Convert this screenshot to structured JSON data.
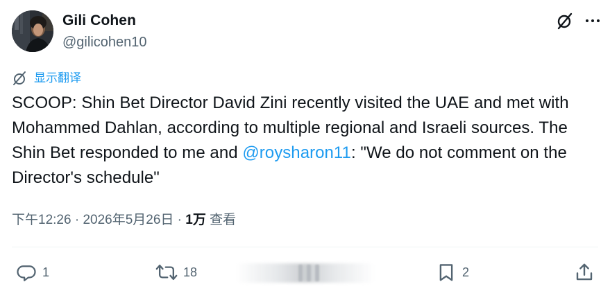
{
  "author": {
    "display_name": "Gili Cohen",
    "handle": "@gilicohen10"
  },
  "header_icons": {
    "grok": "grok-icon",
    "more": "more-icon"
  },
  "translate": {
    "icon": "translate-icon",
    "label": "显示翻译"
  },
  "tweet": {
    "text_part1": "SCOOP: Shin Bet Director David Zini recently visited the UAE and met with Mohammed Dahlan, according to multiple regional and Israeli sources. The Shin Bet responded to me and ",
    "mention": "@roysharon11",
    "text_part2": ": \"We do not comment on the Director's schedule\""
  },
  "meta": {
    "time": "下午12:26",
    "separator1": " · ",
    "date": "2026年5月26日",
    "separator2": " · ",
    "views_count": "1万",
    "views_label": " 查看"
  },
  "actions": {
    "reply": {
      "icon": "reply-icon",
      "count": "1"
    },
    "retweet": {
      "icon": "retweet-icon",
      "count": "18"
    },
    "bookmark": {
      "icon": "bookmark-icon",
      "count": "2"
    },
    "share": {
      "icon": "share-icon"
    }
  },
  "colors": {
    "text": "#0f1419",
    "secondary": "#536471",
    "accent": "#1d9bf0",
    "divider": "#eff3f4"
  }
}
